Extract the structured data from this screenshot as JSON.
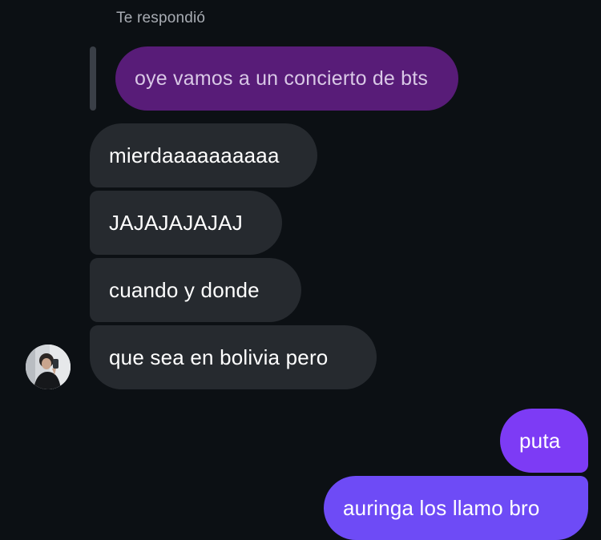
{
  "reply": {
    "header": "Te respondió",
    "quoted_message": "oye vamos a un concierto de bts"
  },
  "received_messages": [
    {
      "text": "mierdaaaaaaaaaa"
    },
    {
      "text": "JAJAJAJAJAJ"
    },
    {
      "text": "cuando y donde"
    },
    {
      "text": "que sea en bolivia pero"
    }
  ],
  "sent_messages": [
    {
      "text": "puta"
    },
    {
      "text": "auringa los llamo bro"
    }
  ],
  "contact": {
    "avatar_icon": "contact-avatar-icon"
  },
  "colors": {
    "background": "#0c1014",
    "received_bubble": "#262a2f",
    "quoted_bubble": "#581c78",
    "sent_bubble_top": "#7d3bf5",
    "sent_bubble_bottom": "#6e4bf6"
  }
}
